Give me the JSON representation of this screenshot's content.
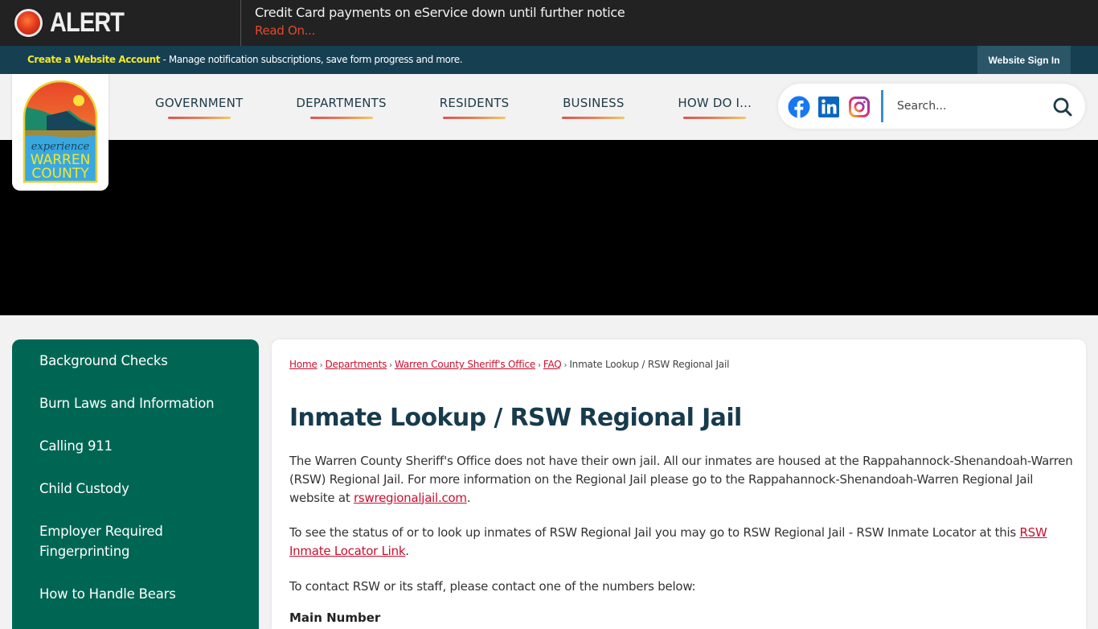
{
  "alert": {
    "label": "ALERT",
    "message": "Credit Card payments on eService down until further notice",
    "read_more": "Read On..."
  },
  "account_bar": {
    "create_link": "Create a Website Account",
    "description": " - Manage notification subscriptions, save form progress and more.",
    "sign_in": "Website Sign In"
  },
  "logo": {
    "line1": "experience",
    "line2": "WARREN",
    "line3": "COUNTY"
  },
  "nav": {
    "items": [
      {
        "label": "GOVERNMENT"
      },
      {
        "label": "DEPARTMENTS"
      },
      {
        "label": "RESIDENTS"
      },
      {
        "label": "BUSINESS"
      },
      {
        "label": "HOW DO I..."
      }
    ]
  },
  "social": {
    "icons": [
      "facebook-icon",
      "linkedin-icon",
      "instagram-icon"
    ],
    "colors": {
      "facebook": "#1877f2",
      "linkedin": "#0a66c2"
    }
  },
  "search": {
    "placeholder": "Search...",
    "value": ""
  },
  "sidebar": {
    "items": [
      {
        "label": "Background Checks"
      },
      {
        "label": "Burn Laws and Information"
      },
      {
        "label": "Calling 911"
      },
      {
        "label": "Child Custody"
      },
      {
        "label": "Employer Required Fingerprinting"
      },
      {
        "label": "How to Handle Bears"
      }
    ]
  },
  "breadcrumb": {
    "items": [
      {
        "label": "Home",
        "link": true
      },
      {
        "label": "Departments",
        "link": true
      },
      {
        "label": "Warren County Sheriff's Office",
        "link": true
      },
      {
        "label": "FAQ",
        "link": true
      },
      {
        "label": "Inmate Lookup / RSW Regional Jail",
        "link": false
      }
    ],
    "separator": "›"
  },
  "main": {
    "title": "Inmate Lookup / RSW Regional Jail",
    "para1_text": "The Warren County Sheriff's Office does not have their own jail. All our inmates are housed at the Rappahannock-Shenandoah-Warren (RSW) Regional Jail. For more information on the Regional Jail please go to the Rappahannock-Shenandoah-Warren Regional Jail website at ",
    "para1_link": "rswregionaljail.com",
    "para1_end": ".",
    "para2_text": "To see the status of or to look up inmates of RSW Regional Jail you may go to RSW Regional Jail - RSW Inmate Locator at this ",
    "para2_link": "RSW Inmate Locator Link",
    "para2_end": ".",
    "para3_text": "To contact RSW or its staff, please contact one of the numbers below:",
    "subhead": "Main Number"
  },
  "colors": {
    "alert_bg": "#222222",
    "alert_link": "#e04a30",
    "account_bar_bg": "#163f52",
    "account_link": "#f3e72a",
    "sidebar_bg": "#006654",
    "title": "#173b4c",
    "link": "#c8102e"
  }
}
